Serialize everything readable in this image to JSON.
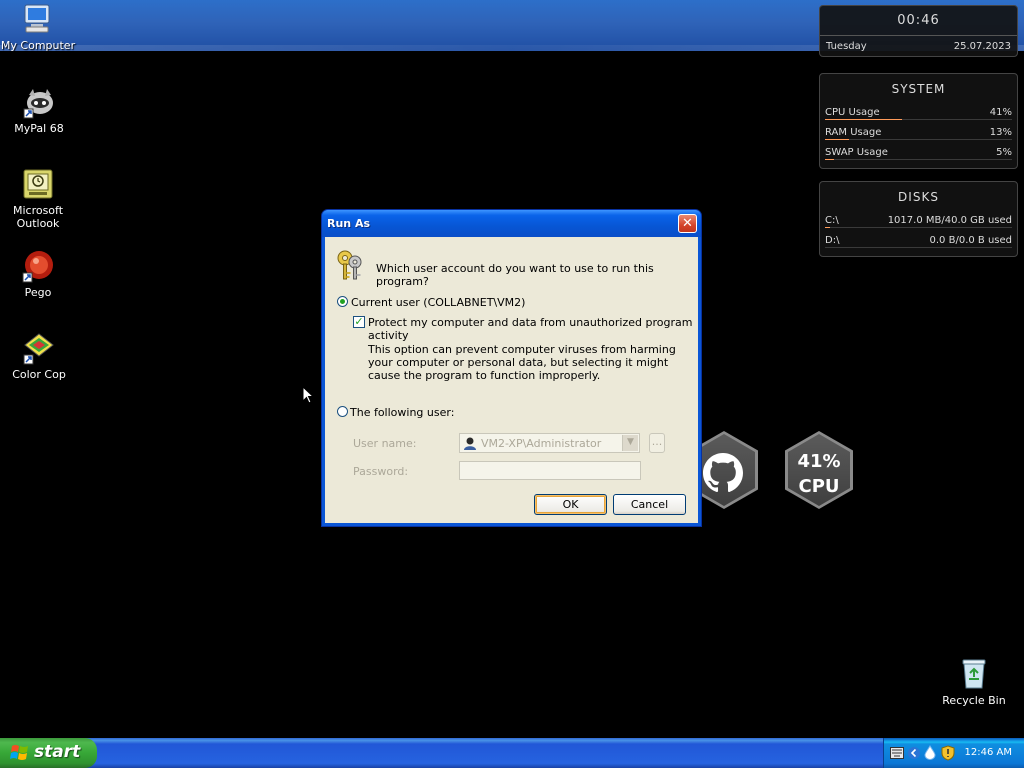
{
  "desktop": {
    "icons": [
      {
        "label": "My Computer",
        "icon": "my-computer-icon"
      },
      {
        "label": "MyPal 68",
        "icon": "mypal-icon"
      },
      {
        "label": "Microsoft Outlook",
        "icon": "outlook-icon"
      },
      {
        "label": "Pego",
        "icon": "pego-icon"
      },
      {
        "label": "Color Cop",
        "icon": "color-cop-icon"
      },
      {
        "label": "Recycle Bin",
        "icon": "recycle-bin-icon"
      }
    ]
  },
  "clock_widget": {
    "time": "00:46",
    "day": "Tuesday",
    "date": "25.07.2023"
  },
  "system_widget": {
    "title": "SYSTEM",
    "rows": [
      {
        "label": "CPU Usage",
        "value": "41%",
        "fraction": 0.41
      },
      {
        "label": "RAM Usage",
        "value": "13%",
        "fraction": 0.13
      },
      {
        "label": "SWAP Usage",
        "value": "5%",
        "fraction": 0.05
      }
    ]
  },
  "disks_widget": {
    "title": "DISKS",
    "rows": [
      {
        "label": "C:\\",
        "value": "1017.0 MB/40.0 GB used",
        "fraction": 0.025
      },
      {
        "label": "D:\\",
        "value": "0.0 B/0.0 B used",
        "fraction": 0.0
      }
    ]
  },
  "cpu_badge": {
    "percent": "41%",
    "label": "CPU"
  },
  "github_badge": {
    "icon": "github-icon"
  },
  "dialog": {
    "title": "Run As",
    "question": "Which user account do you want to use to run this program?",
    "current_user_label": "Current user (COLLABNET\\VM2)",
    "protect_label": "Protect my computer and data from unauthorized program activity",
    "description": "This option can prevent computer viruses from harming your computer or personal data, but selecting it might cause the program to function improperly.",
    "following_user_label": "The following user:",
    "username_label": "User name:",
    "username_value": "VM2-XP\\Administrator",
    "password_label": "Password:",
    "browse_label": "...",
    "ok_label": "OK",
    "cancel_label": "Cancel",
    "close_glyph": "✕"
  },
  "taskbar": {
    "start_label": "start",
    "time": "12:46 AM"
  }
}
